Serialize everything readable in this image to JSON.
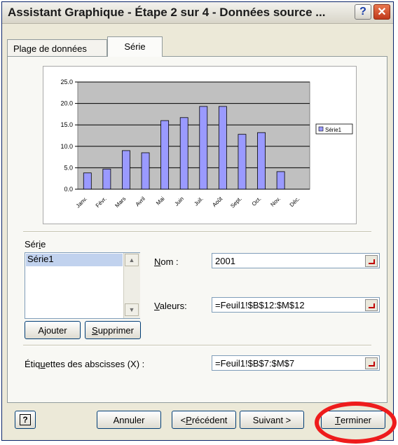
{
  "window": {
    "title": "Assistant Graphique - Étape 2 sur 4 - Données source ..."
  },
  "tabs": [
    {
      "label": "Plage de données"
    },
    {
      "label": "Série"
    }
  ],
  "chart_data": {
    "type": "bar",
    "categories": [
      "Janv.",
      "Févr.",
      "Mars",
      "Avril",
      "Mai",
      "Juin",
      "Juil.",
      "Août",
      "Sept.",
      "Oct.",
      "Nov.",
      "Déc."
    ],
    "series": [
      {
        "name": "Série1",
        "values": [
          3.8,
          4.7,
          9.0,
          8.5,
          16.0,
          16.7,
          19.3,
          19.3,
          12.8,
          13.2,
          4.1,
          0
        ]
      }
    ],
    "yticks": [
      "25.0",
      "20.0",
      "15.0",
      "10.0",
      "5.0",
      "0.0"
    ],
    "ylim": [
      0,
      25
    ],
    "grid": true,
    "legend": "right",
    "colors": {
      "bar": "#9a9aff",
      "plot_bg": "#c0c0c0",
      "bar_stroke": "#000000"
    }
  },
  "serie": {
    "group_label_pre": "Sér",
    "group_label_acc": "i",
    "group_label_post": "e",
    "items": [
      "Série1"
    ],
    "add_pre": "A",
    "add_acc": "j",
    "add_post": "outer",
    "remove_acc": "S",
    "remove_post": "upprimer"
  },
  "fields": {
    "name_label_acc": "N",
    "name_label_post": "om :",
    "name_value": "2001",
    "values_label_acc": "V",
    "values_label_post": "aleurs:",
    "values_value": "=Feuil1!$B$12:$M$12",
    "categories_label_pre": "Étiq",
    "categories_label_acc": "u",
    "categories_label_post": "ettes des abscisses (X) :",
    "categories_value": "=Feuil1!$B$7:$M$7"
  },
  "footer": {
    "cancel": "Annuler",
    "prev_pre": "< ",
    "prev_acc": "P",
    "prev_post": "récédent",
    "next": "Suivant >",
    "finish_acc": "T",
    "finish_post": "erminer"
  }
}
